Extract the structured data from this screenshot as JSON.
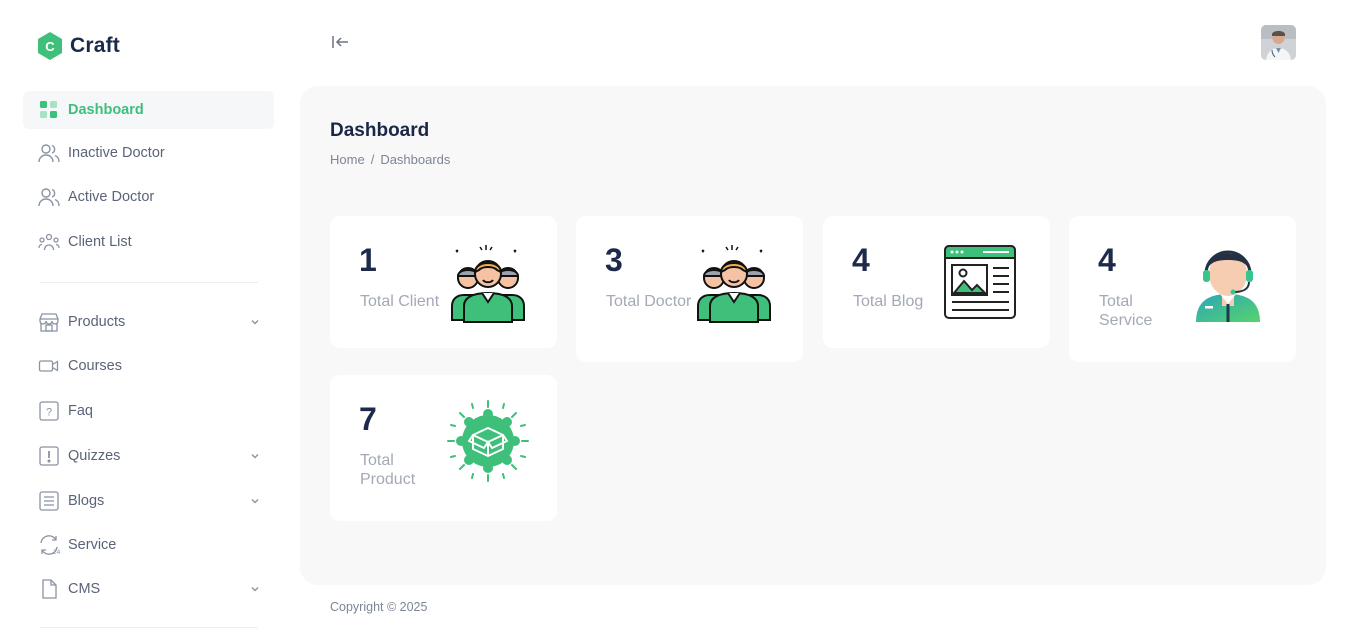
{
  "app": {
    "name": "Craft",
    "logo_letter": "C",
    "accent": "#3ec07a"
  },
  "sidebar": {
    "items": [
      {
        "label": "Dashboard",
        "icon": "dashboard-grid-icon",
        "active": true
      },
      {
        "label": "Inactive Doctor",
        "icon": "users-icon"
      },
      {
        "label": "Active Doctor",
        "icon": "users-icon"
      },
      {
        "label": "Client List",
        "icon": "group-icon"
      },
      {
        "label": "Products",
        "icon": "store-icon",
        "expandable": true
      },
      {
        "label": "Courses",
        "icon": "video-icon"
      },
      {
        "label": "Faq",
        "icon": "question-icon"
      },
      {
        "label": "Quizzes",
        "icon": "exclamation-icon",
        "expandable": true
      },
      {
        "label": "Blogs",
        "icon": "list-icon",
        "expandable": true
      },
      {
        "label": "Service",
        "icon": "24h-service-icon"
      },
      {
        "label": "CMS",
        "icon": "file-icon",
        "expandable": true
      }
    ]
  },
  "header": {
    "collapse_icon": "collapse-left-icon",
    "avatar": "user-avatar"
  },
  "page": {
    "title": "Dashboard",
    "breadcrumb": [
      "Home",
      "/",
      "Dashboards"
    ]
  },
  "stats": [
    {
      "value": "1",
      "caption": "Total Client",
      "icon": "people-group-icon"
    },
    {
      "value": "3",
      "caption": "Total Doctor",
      "icon": "people-group-icon"
    },
    {
      "value": "4",
      "caption": "Total Blog",
      "icon": "blog-window-icon"
    },
    {
      "value": "4",
      "caption": "Total Service",
      "icon": "support-agent-icon"
    },
    {
      "value": "7",
      "caption": "Total Product",
      "icon": "product-box-icon"
    }
  ],
  "footer": {
    "text": "Copyright © 2025"
  }
}
